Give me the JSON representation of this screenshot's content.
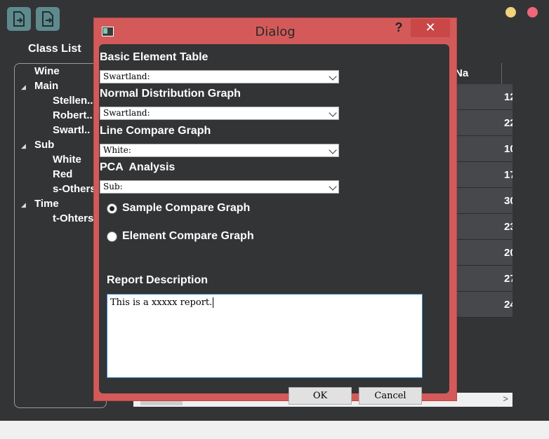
{
  "toolbar": {
    "import_icon": "file-import-icon",
    "export_icon": "file-export-icon"
  },
  "window_controls": {
    "minimize_color": "#f2d27a",
    "close_color": "#f0677a"
  },
  "sidebar": {
    "title": "Class List",
    "tree": [
      {
        "label": "Wine"
      },
      {
        "label": "Main",
        "expanded": true
      },
      {
        "label": "Stellen.."
      },
      {
        "label": "Robert.."
      },
      {
        "label": "Swartl.."
      },
      {
        "label": "Sub",
        "expanded": true
      },
      {
        "label": "White"
      },
      {
        "label": "Red"
      },
      {
        "label": "s-Others"
      },
      {
        "label": "Time",
        "expanded": true
      },
      {
        "label": "t-Ohters"
      }
    ]
  },
  "table": {
    "column_header": "Na",
    "row_values": [
      "12",
      "22",
      "10",
      "17",
      "30",
      "23",
      "20",
      "27",
      "24"
    ]
  },
  "dialog": {
    "title": "Dialog",
    "help_label": "?",
    "close_label": "✕",
    "sections": [
      {
        "label": "Basic Element Table",
        "value": "Swartland:"
      },
      {
        "label": "Normal Distribution Graph",
        "value": "Swartland:"
      },
      {
        "label": "Line Compare Graph",
        "value": "White:"
      },
      {
        "label": "PCA  Analysis",
        "value": "Sub:"
      }
    ],
    "radios": [
      {
        "label": "Sample Compare Graph",
        "checked": true
      },
      {
        "label": "Element Compare Graph",
        "checked": false
      }
    ],
    "report_label": "Report Description",
    "report_text": "This is a xxxxx report.",
    "ok_label": "OK",
    "cancel_label": "Cancel"
  }
}
